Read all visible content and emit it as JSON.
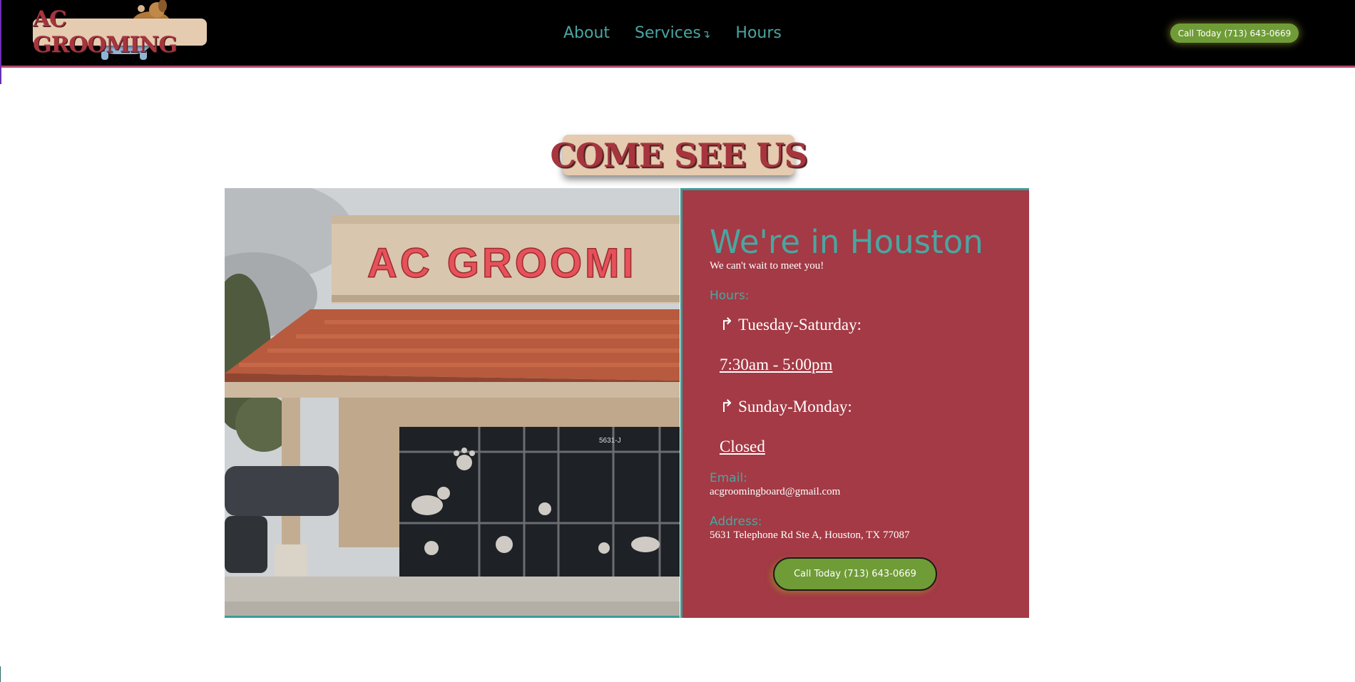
{
  "header": {
    "logo_text": "AC GROOMING",
    "nav": [
      {
        "label": "About"
      },
      {
        "label": "Services",
        "dropdown_icon": "down-arrow-icon"
      },
      {
        "label": "Hours"
      }
    ],
    "call_button": "Call Today (713) 643-0669"
  },
  "main": {
    "title": "COME SEE US",
    "photo_sign_text": "AC GROOMI",
    "photo_unit_text": "5631-J",
    "info": {
      "heading": "We're in Houston",
      "subheading": "We can't wait to meet you!",
      "hours_label": "Hours:",
      "hours": [
        {
          "days": "Tuesday-Saturday:",
          "time": "7:30am - 5:00pm"
        },
        {
          "days": "Sunday-Monday:",
          "time": "Closed"
        }
      ],
      "email_label": "Email:",
      "email": "acgroomingboard@gmail.com",
      "address_label": "Address:",
      "address": "5631 Telephone Rd Ste A, Houston, TX 77087",
      "call_button": "Call Today (713) 643-0669"
    }
  },
  "colors": {
    "header_bg": "#000000",
    "nav_text": "#4aa6a2",
    "brand_red": "#a6353e",
    "panel_bg": "#a33a45",
    "accent_teal": "#3a9d97",
    "button_green": "#6f9c36"
  }
}
